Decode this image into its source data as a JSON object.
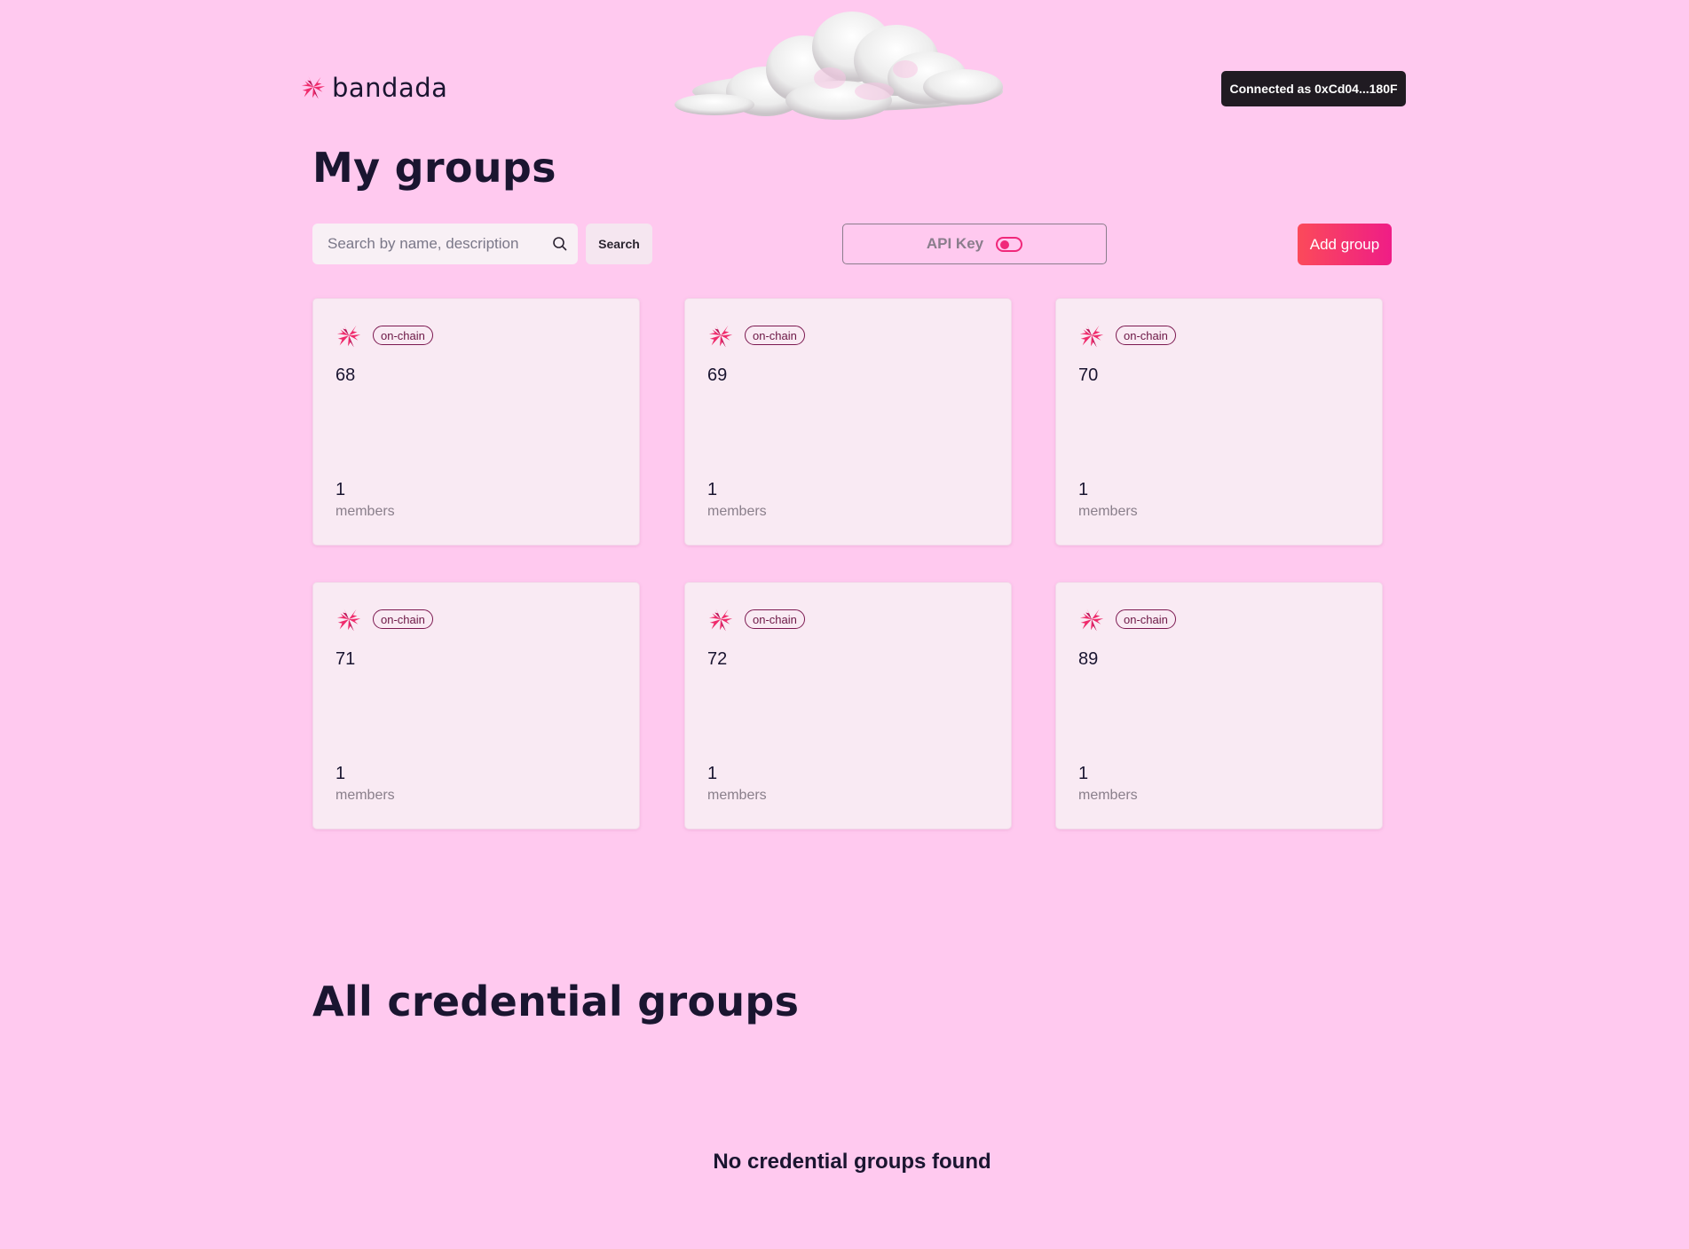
{
  "header": {
    "brand": "bandada",
    "connected_label": "Connected as 0xCd04...180F"
  },
  "page_title": "My groups",
  "search": {
    "placeholder": "Search by name, description",
    "value": "",
    "button_label": "Search"
  },
  "api_key": {
    "label": "API Key",
    "enabled": false
  },
  "add_group_label": "Add group",
  "groups": [
    {
      "name": "68",
      "badge": "on-chain",
      "members_count": "1",
      "members_label": "members"
    },
    {
      "name": "69",
      "badge": "on-chain",
      "members_count": "1",
      "members_label": "members"
    },
    {
      "name": "70",
      "badge": "on-chain",
      "members_count": "1",
      "members_label": "members"
    },
    {
      "name": "71",
      "badge": "on-chain",
      "members_count": "1",
      "members_label": "members"
    },
    {
      "name": "72",
      "badge": "on-chain",
      "members_count": "1",
      "members_label": "members"
    },
    {
      "name": "89",
      "badge": "on-chain",
      "members_count": "1",
      "members_label": "members"
    }
  ],
  "credential_section": {
    "title": "All credential groups",
    "empty_message": "No credential groups found"
  },
  "icons": {
    "logo": "bandada-flock-icon",
    "cloud": "cloud-illustration",
    "search": "search-icon"
  },
  "colors": {
    "background": "#ffc9ef",
    "brand_pink": "#f0287a",
    "brand_red": "#fb4a5a",
    "dark": "#201b22"
  }
}
